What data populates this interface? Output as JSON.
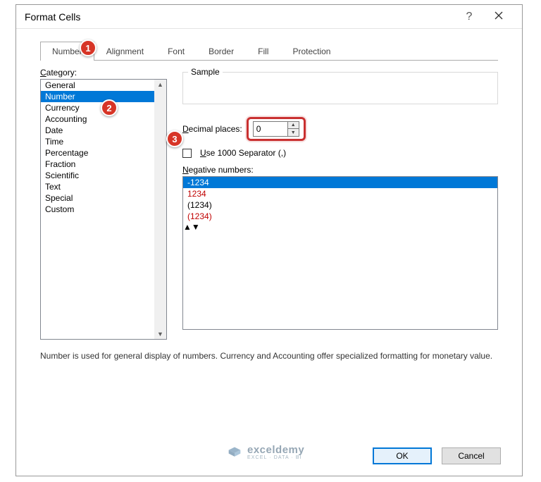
{
  "title": "Format Cells",
  "tabs": [
    "Number",
    "Alignment",
    "Font",
    "Border",
    "Fill",
    "Protection"
  ],
  "categoryLabel": "Category:",
  "categories": [
    "General",
    "Number",
    "Currency",
    "Accounting",
    "Date",
    "Time",
    "Percentage",
    "Fraction",
    "Scientific",
    "Text",
    "Special",
    "Custom"
  ],
  "sampleLabel": "Sample",
  "decimalLabel": "Decimal places:",
  "decimalValue": "0",
  "sepLabel": "Use 1000 Separator (,)",
  "negLabel": "Negative numbers:",
  "negItems": [
    {
      "text": "-1234",
      "cls": "sel"
    },
    {
      "text": "1234",
      "cls": "red"
    },
    {
      "text": "(1234)",
      "cls": ""
    },
    {
      "text": "(1234)",
      "cls": "red"
    }
  ],
  "desc": "Number is used for general display of numbers.  Currency and Accounting offer specialized formatting for monetary value.",
  "ok": "OK",
  "cancel": "Cancel",
  "wmBrand": "exceldemy",
  "wmSub": "EXCEL · DATA · BI",
  "callouts": {
    "c1": "1",
    "c2": "2",
    "c3": "3"
  }
}
